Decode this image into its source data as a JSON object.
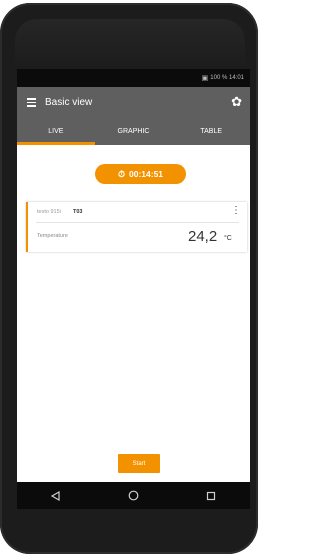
{
  "status_bar": {
    "text": "100 %  14:01"
  },
  "app_bar": {
    "title": "Basic view"
  },
  "tabs": [
    {
      "label": "LIVE",
      "active": true
    },
    {
      "label": "GRAPHIC",
      "active": false
    },
    {
      "label": "TABLE",
      "active": false
    }
  ],
  "timer": {
    "value": "00:14:51"
  },
  "probe_card": {
    "name": "testo 915i",
    "id": "T03",
    "parameter": "Temperature",
    "value": "24,2",
    "unit": "°C"
  },
  "start_button": {
    "label": "Start"
  },
  "colors": {
    "accent": "#f39200",
    "app_bar": "#5f5f5f",
    "phone_body": "#1c1c1c"
  },
  "icons": [
    "menu-icon",
    "gear-icon",
    "clock-icon",
    "more-vert-icon",
    "back-icon",
    "home-icon",
    "recents-icon"
  ]
}
